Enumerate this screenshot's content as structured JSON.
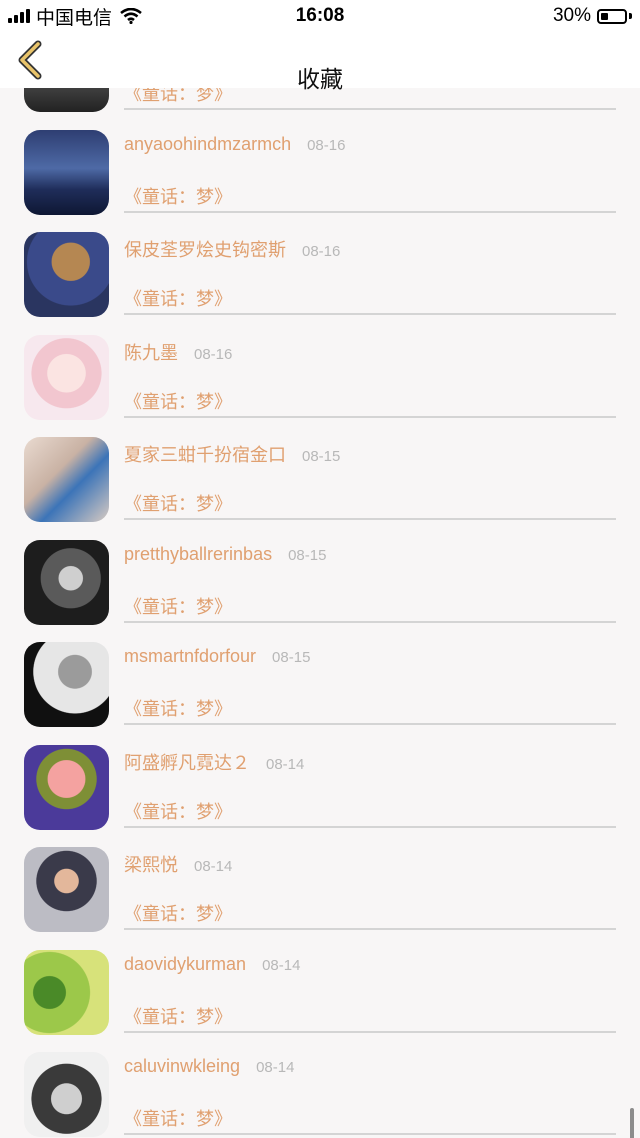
{
  "status_bar": {
    "carrier": "中国电信",
    "time": "16:08",
    "battery_text": "30%",
    "battery_level": 0.3
  },
  "nav": {
    "title": "收藏"
  },
  "items": [
    {
      "name": "",
      "date": "",
      "work": "《童话：梦》",
      "avatar": "silhouette-dark-avatar"
    },
    {
      "name": "anyaoohindmzarmch",
      "date": "08-16",
      "work": "《童话：梦》",
      "avatar": "pier-dusk-avatar"
    },
    {
      "name": "保皮荃罗烩史钩密斯",
      "date": "08-16",
      "work": "《童话：梦》",
      "avatar": "cartoon-character-avatar"
    },
    {
      "name": "陈九墨",
      "date": "08-16",
      "work": "《童话：梦》",
      "avatar": "anime-girl-avatar"
    },
    {
      "name": "夏家三蚶千扮宿金口",
      "date": "08-15",
      "work": "《童话：梦》",
      "avatar": "boy-bottle-avatar"
    },
    {
      "name": "pretthyballrerinbas",
      "date": "08-15",
      "work": "《童话：梦》",
      "avatar": "bw-portrait-avatar"
    },
    {
      "name": "msmartnfdorfour",
      "date": "08-15",
      "work": "《童话：梦》",
      "avatar": "bw-curly-hair-avatar"
    },
    {
      "name": "阿盛孵凡霓达２",
      "date": "08-14",
      "work": "《童话：梦》",
      "avatar": "pink-flowers-avatar"
    },
    {
      "name": "梁熙悦",
      "date": "08-14",
      "work": "《童话：梦》",
      "avatar": "child-photo-avatar"
    },
    {
      "name": "daovidykurman",
      "date": "08-14",
      "work": "《童话：梦》",
      "avatar": "clover-green-avatar"
    },
    {
      "name": "caluvinwkleing",
      "date": "08-14",
      "work": "《童话：梦》",
      "avatar": "bw-man-smoking-avatar"
    }
  ],
  "colors": {
    "accent": "#e0a070",
    "date": "#b8b8b8",
    "back_arrow": "#e9c46a",
    "background": "#f8f6f6"
  }
}
